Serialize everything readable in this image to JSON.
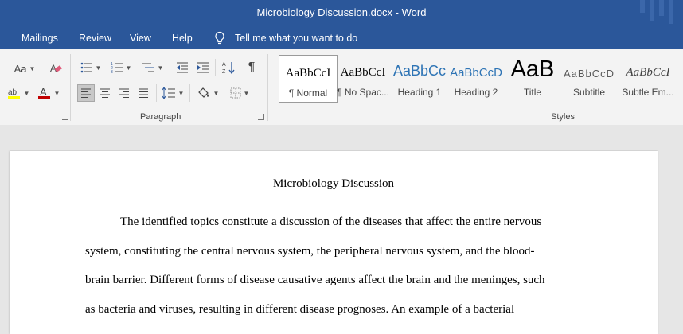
{
  "window": {
    "title": "Microbiology Discussion.docx  -  Word"
  },
  "tabs": [
    "Mailings",
    "Review",
    "View",
    "Help"
  ],
  "tell_me": "Tell me what you want to do",
  "ribbon": {
    "font_aa_label": "Aa",
    "paragraph_label": "Paragraph",
    "styles_label": "Styles",
    "pilcrow": "¶",
    "colors": {
      "highlight": "#ffff00",
      "font_color": "#c00000"
    },
    "styles": [
      {
        "preview": "AaBbCcI",
        "name": "¶ Normal"
      },
      {
        "preview": "AaBbCcI",
        "name": "¶ No Spac..."
      },
      {
        "preview": "AaBbCc",
        "name": "Heading 1"
      },
      {
        "preview": "AaBbCcD",
        "name": "Heading 2"
      },
      {
        "preview": "AaB",
        "name": "Title"
      },
      {
        "preview": "AaBbCcD",
        "name": "Subtitle"
      },
      {
        "preview": "AaBbCcI",
        "name": "Subtle Em..."
      }
    ]
  },
  "document": {
    "title": "Microbiology Discussion",
    "lines": [
      "The identified topics constitute a discussion of the diseases that affect the entire nervous",
      "system, constituting the central nervous system, the peripheral nervous system, and the blood-",
      "brain barrier. Different forms of disease causative agents affect the brain and the meninges, such",
      "as bacteria and viruses, resulting in different disease prognoses. An example of a bacterial"
    ]
  }
}
